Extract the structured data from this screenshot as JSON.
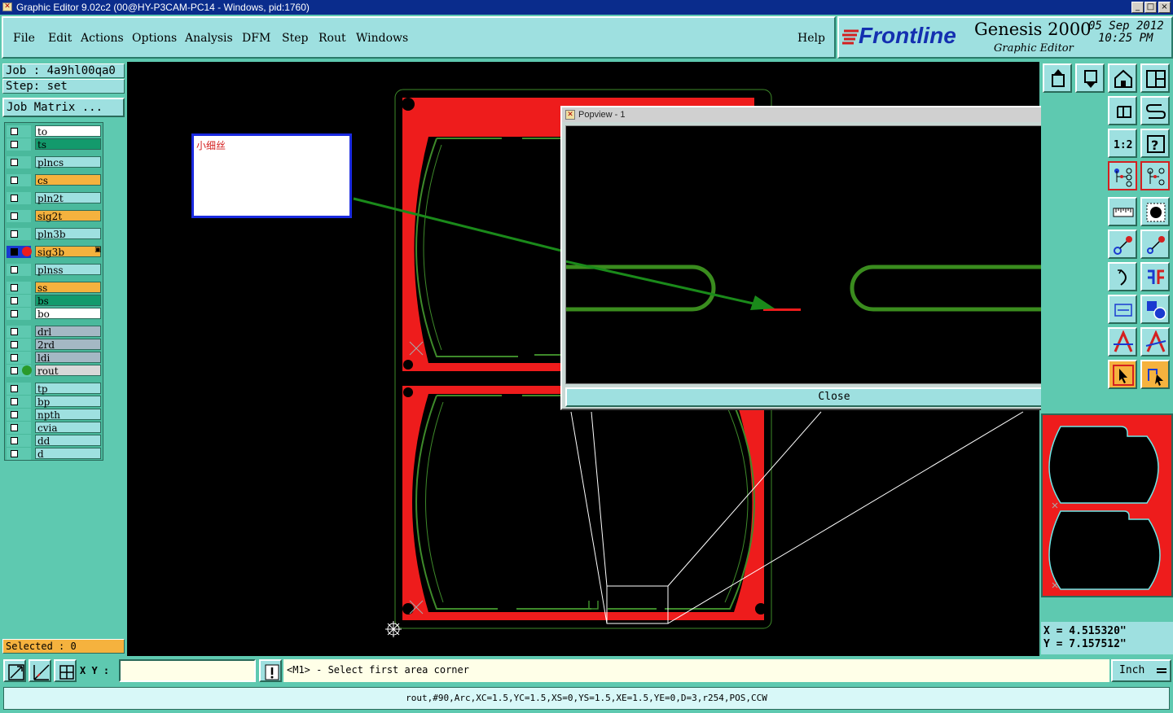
{
  "window": {
    "title": "Graphic Editor 9.02c2 (00@HY-P3CAM-PC14 - Windows, pid:1760)",
    "buttons": [
      "_",
      "□",
      "×"
    ]
  },
  "menu": {
    "items": [
      "File",
      "Edit",
      "Actions",
      "Options",
      "Analysis",
      "DFM",
      "Step",
      "Rout",
      "Windows"
    ],
    "help": "Help"
  },
  "brand": {
    "logo": "Frontline",
    "product": "Genesis 2000",
    "subtitle": "Graphic Editor",
    "date": "05 Sep 2012",
    "time": "10:25 PM"
  },
  "job": {
    "job_line": "Job : 4a9hl00qa0",
    "step_line": "Step: set",
    "matrix_button": "Job Matrix ..."
  },
  "layers": [
    {
      "name": "to",
      "color": "#ffffff",
      "group": 0
    },
    {
      "name": "ts",
      "color": "#139a6c",
      "group": 0
    },
    {
      "name": "plncs",
      "color": "#9ee0e0",
      "group": 1
    },
    {
      "name": "cs",
      "color": "#f5b23e",
      "group": 2
    },
    {
      "name": "pln2t",
      "color": "#9ee0e0",
      "group": 3
    },
    {
      "name": "sig2t",
      "color": "#f5b23e",
      "group": 4
    },
    {
      "name": "pln3b",
      "color": "#9ee0e0",
      "group": 5
    },
    {
      "name": "sig3b",
      "color": "#f5b23e",
      "group": 6,
      "active": true
    },
    {
      "name": "plnss",
      "color": "#9ee0e0",
      "group": 7
    },
    {
      "name": "ss",
      "color": "#f5b23e",
      "group": 8
    },
    {
      "name": "bs",
      "color": "#139a6c",
      "group": 8
    },
    {
      "name": "bo",
      "color": "#ffffff",
      "group": 8
    },
    {
      "name": "drl",
      "color": "#a4b8c4",
      "group": 9
    },
    {
      "name": "2rd",
      "color": "#a4b8c4",
      "group": 9
    },
    {
      "name": "ldi",
      "color": "#a4b8c4",
      "group": 9
    },
    {
      "name": "rout",
      "color": "#d8d8d8",
      "group": 9,
      "shown": true
    },
    {
      "name": "tp",
      "color": "#9ee0e0",
      "group": 10
    },
    {
      "name": "bp",
      "color": "#9ee0e0",
      "group": 10
    },
    {
      "name": "npth",
      "color": "#9ee0e0",
      "group": 10
    },
    {
      "name": "cvia",
      "color": "#9ee0e0",
      "group": 10
    },
    {
      "name": "dd",
      "color": "#9ee0e0",
      "group": 10
    },
    {
      "name": "d",
      "color": "#9ee0e0",
      "group": 10
    }
  ],
  "selected": "Selected : 0",
  "annotation": {
    "text": "小细丝"
  },
  "popview": {
    "title": "Popview - 1",
    "close_label": "Close"
  },
  "coords": {
    "x": "X = 4.515320\"",
    "y": "Y = 7.157512\""
  },
  "status": {
    "xy_label": "X Y :",
    "xy_value": "",
    "prompt": "<M1> - Select first area corner",
    "units": "Inch"
  },
  "feature_info": "rout,#90,Arc,XC=1.5,YC=1.5,XS=0,YS=1.5,XE=1.5,YE=0,D=3,r254,POS,CCW"
}
